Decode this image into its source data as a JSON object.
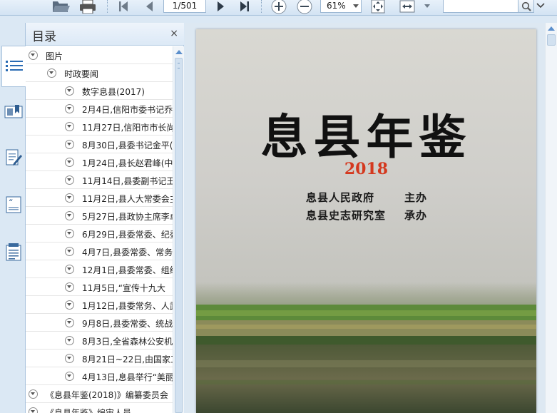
{
  "toolbar": {
    "page_indicator": "1/501",
    "zoom": "61%",
    "search_value": ""
  },
  "panel": {
    "title": "目录",
    "close_glyph": "×"
  },
  "outline": [
    {
      "label": "图片",
      "level": 0
    },
    {
      "label": "时政要闻",
      "level": 1
    },
    {
      "label": "数字息县(2017)",
      "level": 2
    },
    {
      "label": "2月4日,信阳市委书记乔",
      "level": 2
    },
    {
      "label": "11月27日,信阳市市长尚",
      "level": 2
    },
    {
      "label": "8月30日,县委书记金平(",
      "level": 2
    },
    {
      "label": "1月24日,县长赵君峰(中",
      "level": 2
    },
    {
      "label": "11月14日,县委副书记王",
      "level": 2
    },
    {
      "label": "11月2日,县人大常委会主",
      "level": 2
    },
    {
      "label": "5月27日,县政协主席李卓",
      "level": 2
    },
    {
      "label": "6月29日,县委常委、纪委",
      "level": 2
    },
    {
      "label": "4月7日,县委常委、常务",
      "level": 2
    },
    {
      "label": "12月1日,县委常委、组织",
      "level": 2
    },
    {
      "label": "11月5日,“宣传十九大 ",
      "level": 2
    },
    {
      "label": "1月12日,县委常务、人武",
      "level": 2
    },
    {
      "label": "9月8日,县委常委、统战",
      "level": 2
    },
    {
      "label": "8月3日,全省森林公安机",
      "level": 2
    },
    {
      "label": "8月21日~22日,由国家工",
      "level": 2
    },
    {
      "label": "4月13日,息县举行“美丽",
      "level": 2
    },
    {
      "label": "《息县年鉴(2018)》编纂委员会",
      "level": 0
    },
    {
      "label": "《息县年鉴》编审人员",
      "level": 0
    }
  ],
  "cover": {
    "title": "息县年鉴",
    "year": "2018",
    "org1": "息县人民政府",
    "role1": "主办",
    "org2": "息县史志研究室",
    "role2": "承办"
  },
  "icons": [
    "open-folder-icon",
    "print-icon",
    "first-page-icon",
    "prev-page-icon",
    "next-page-icon",
    "last-page-icon",
    "zoom-in-icon",
    "zoom-out-icon",
    "fit-page-icon",
    "fit-width-icon",
    "search-icon",
    "outline-icon",
    "bookmark-icon",
    "annotation-icon",
    "quote-icon",
    "notes-icon"
  ]
}
